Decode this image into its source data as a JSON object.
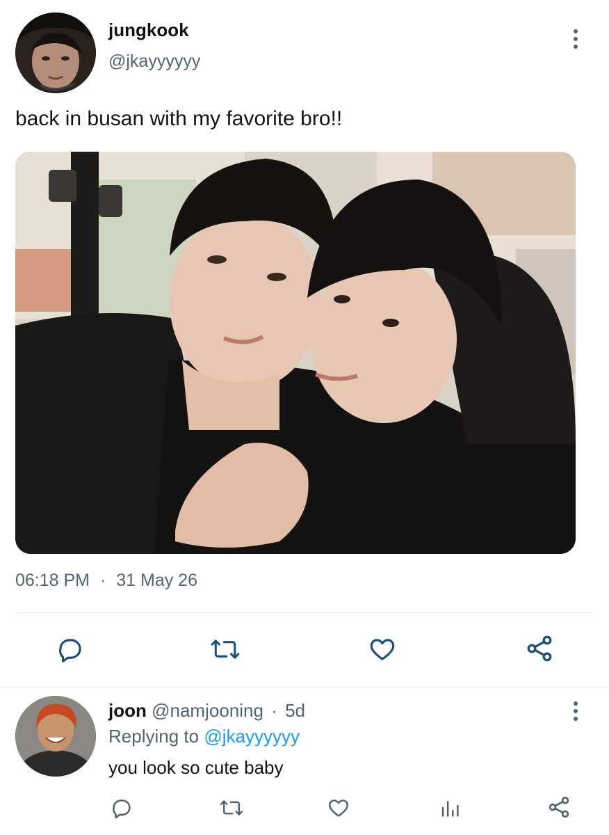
{
  "tweet": {
    "author_name": "jungkook",
    "author_handle": "@jkayyyyyy",
    "text": "back in busan with my favorite bro!!",
    "time": "06:18 PM",
    "separator": "·",
    "date": "31 May 26",
    "actions": [
      "reply-icon",
      "retweet-icon",
      "like-icon",
      "share-icon"
    ]
  },
  "reply": {
    "author_name": "joon",
    "author_handle": "@namjooning",
    "separator": "·",
    "age": "5d",
    "replying_label": "Replying to",
    "replying_handle": "@jkayyyyyy",
    "text": "you look so cute baby",
    "actions": [
      "reply-icon",
      "retweet-icon",
      "like-icon",
      "analytics-icon",
      "share-icon"
    ]
  },
  "colors": {
    "text": "#0f1419",
    "secondary": "#536471",
    "link": "#1d9bf0",
    "divider": "#e6ecf0"
  }
}
